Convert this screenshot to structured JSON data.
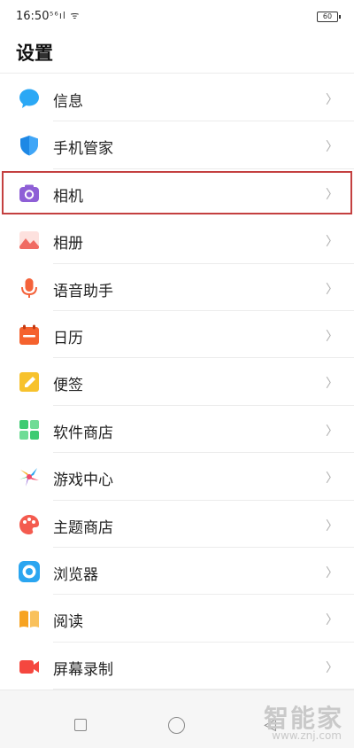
{
  "status_bar": {
    "time": "16:50",
    "signal_text": "⁵⁶ıl ᯤ",
    "battery": "60"
  },
  "page": {
    "title": "设置"
  },
  "settings": [
    {
      "label": "信息",
      "icon": "message-icon",
      "color": "#2ba8f5"
    },
    {
      "label": "手机管家",
      "icon": "shield-icon",
      "color": "#1e88e5"
    },
    {
      "label": "相机",
      "icon": "camera-icon",
      "color": "#8e5fd6",
      "highlighted": true
    },
    {
      "label": "相册",
      "icon": "gallery-icon",
      "color": "#f06a62"
    },
    {
      "label": "语音助手",
      "icon": "microphone-icon",
      "color": "#f4623a"
    },
    {
      "label": "日历",
      "icon": "calendar-icon",
      "color": "#f5622e"
    },
    {
      "label": "便签",
      "icon": "note-icon",
      "color": "#f7c22d"
    },
    {
      "label": "软件商店",
      "icon": "app-store-icon",
      "color": "#3ecb72"
    },
    {
      "label": "游戏中心",
      "icon": "game-center-icon",
      "color": "#f04a6a"
    },
    {
      "label": "主题商店",
      "icon": "theme-store-icon",
      "color": "#f45b4f"
    },
    {
      "label": "浏览器",
      "icon": "browser-icon",
      "color": "#2aa5f0"
    },
    {
      "label": "阅读",
      "icon": "reader-icon",
      "color": "#f7a321"
    },
    {
      "label": "屏幕录制",
      "icon": "screen-record-icon",
      "color": "#f5473f"
    }
  ],
  "watermark": {
    "logo": "智能家",
    "url": "www.znj.com"
  }
}
